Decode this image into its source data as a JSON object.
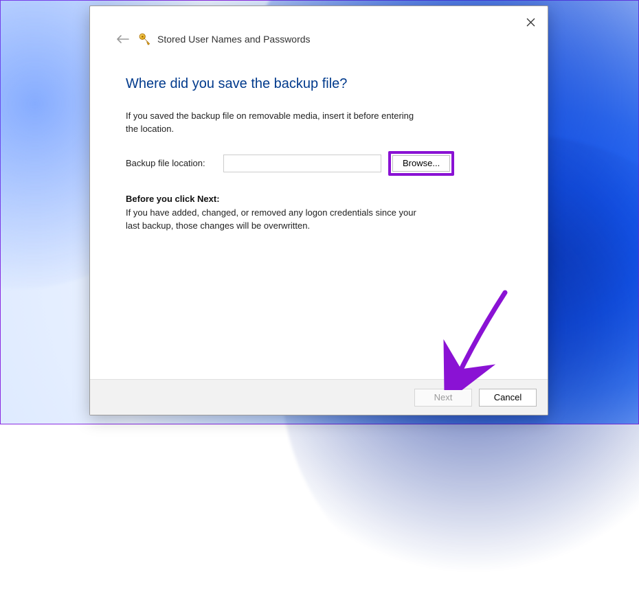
{
  "header": {
    "title": "Stored User Names and Passwords"
  },
  "body": {
    "heading": "Where did you save the backup file?",
    "instruction": "If you saved the backup file on removable media, insert it before entering the location.",
    "file_label": "Backup file location:",
    "file_value": "",
    "browse_label": "Browse...",
    "note_bold": "Before you click Next:",
    "note_text": "If you have added, changed, or removed any logon credentials since your last backup, those changes will be overwritten."
  },
  "footer": {
    "next_label": "Next",
    "cancel_label": "Cancel"
  },
  "annotation": {
    "highlight_color": "#8a12d4",
    "arrow_color": "#8a12d4"
  }
}
